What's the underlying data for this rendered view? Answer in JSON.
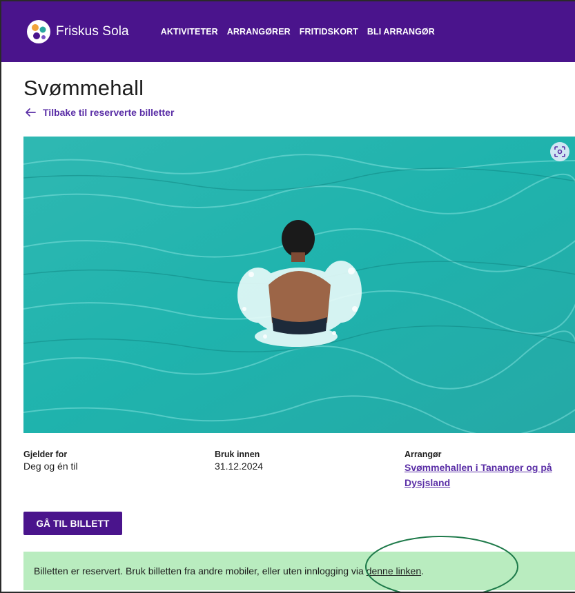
{
  "header": {
    "brand_name": "Friskus Sola",
    "nav": [
      "AKTIVITETER",
      "ARRANGØRER",
      "FRITIDSKORT",
      "BLI ARRANGØR"
    ]
  },
  "page": {
    "title": "Svømmehall",
    "back_link": "Tilbake til reserverte billetter"
  },
  "info": {
    "applies_label": "Gjelder for",
    "applies_value": "Deg og én til",
    "use_before_label": "Bruk innen",
    "use_before_value": "31.12.2024",
    "organizer_label": "Arrangør",
    "organizer_value": "Svømmehallen i Tananger og på Dysjsland"
  },
  "actions": {
    "ticket_button": "GÅ TIL BILLETT"
  },
  "alert": {
    "text": "Billetten er reservert. Bruk billetten fra andre mobiler, eller uten innlogging via ",
    "link": "denne linken",
    "suffix": "."
  },
  "colors": {
    "brand": "#4a148c",
    "link": "#5a2ea6",
    "alert_bg": "#b9ecbf",
    "annotation": "#1e7a4a"
  },
  "icons": [
    "friskus-logo-icon",
    "arrow-left-icon",
    "focus-icon"
  ]
}
